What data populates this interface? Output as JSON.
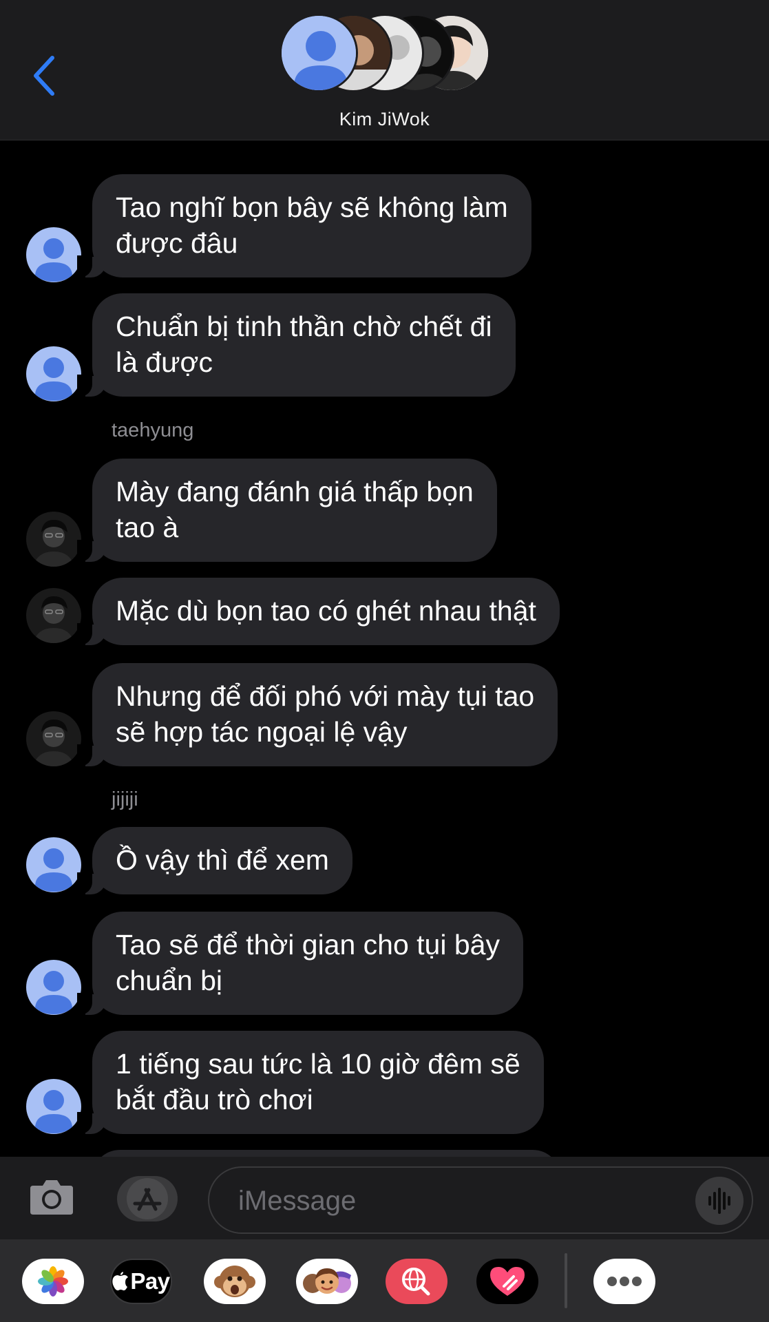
{
  "header": {
    "contact_name": "Kim JiWok",
    "back_icon": "chevron-left-icon"
  },
  "messages": [
    {
      "sender": "",
      "avatar": "default-contact-avatar",
      "text": "Tao nghĩ bọn bây sẽ không làm\nđược đâu"
    },
    {
      "sender": "",
      "avatar": "default-contact-avatar",
      "text": "Chuẩn bị tinh thần chờ chết đi\nlà được"
    },
    {
      "sender": "taehyung",
      "avatar": "photo-avatar",
      "text": "Mày đang đánh giá thấp bọn\ntao à"
    },
    {
      "sender": "",
      "avatar": "photo-avatar",
      "text": "Mặc dù bọn tao có ghét nhau thật"
    },
    {
      "sender": "",
      "avatar": "photo-avatar",
      "text": "Nhưng để đối phó với mày tụi tao\nsẽ hợp tác ngoại lệ vậy"
    },
    {
      "sender": "jijiji",
      "avatar": "default-contact-avatar",
      "text": "Ồ vậy thì để xem"
    },
    {
      "sender": "",
      "avatar": "default-contact-avatar",
      "text": "Tao sẽ để thời gian cho tụi bây\nchuẩn bị"
    },
    {
      "sender": "",
      "avatar": "default-contact-avatar",
      "text": "1 tiếng sau tức là 10 giờ đêm sẽ\nbắt đầu trò chơi"
    }
  ],
  "input": {
    "placeholder": "iMessage",
    "value": ""
  },
  "drawer": {
    "apple_pay_label": "Pay",
    "apps": [
      "photos-icon",
      "apple-pay-icon",
      "animoji-icon",
      "memoji-icon",
      "web-search-icon",
      "digital-touch-icon",
      "more-icon"
    ]
  },
  "colors": {
    "accent": "#2f7cf6",
    "bubble": "#26262a",
    "header_bg": "#1c1c1e",
    "default_avatar": "#a8c0f5"
  }
}
